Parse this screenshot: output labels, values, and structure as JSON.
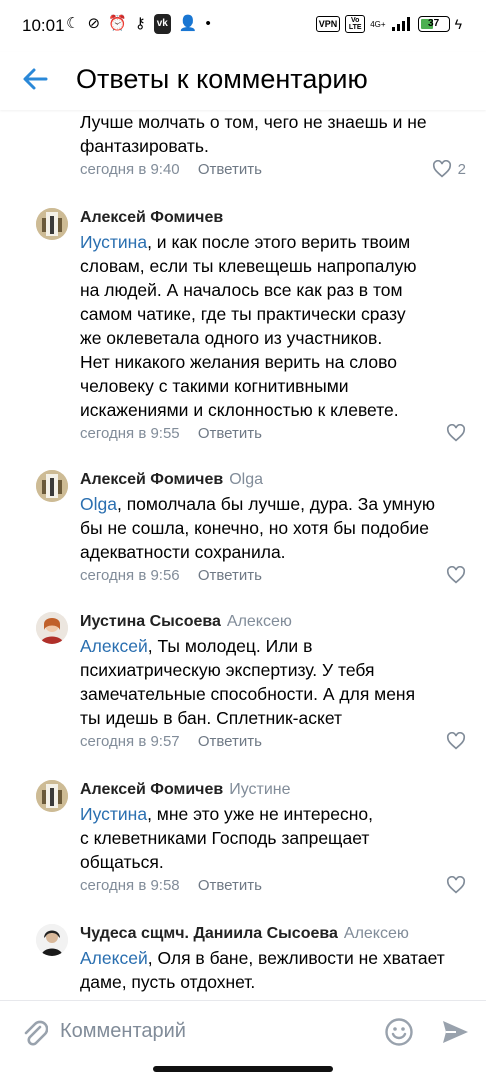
{
  "status_bar": {
    "time": "10:01",
    "vpn": "VPN",
    "volte": "Vo LTE",
    "network": "4G+",
    "battery": "37"
  },
  "header": {
    "title": "Ответы к комментарию"
  },
  "comments": [
    {
      "text_lines": [
        "Лучше молчать о том, чего не знаешь и не",
        "фантазировать."
      ],
      "time": "сегодня в 9:40",
      "reply_label": "Ответить",
      "likes": "2"
    },
    {
      "author": "Алексей Фомичев",
      "reply_to": "",
      "mention": "Иустина",
      "text_lines": [
        ", и как после этого верить твоим",
        "словам, если ты клевещешь напропалую",
        "на людей. А началось все как раз в том",
        "самом чатике, где ты практически сразу",
        "же оклеветала одного из участников.",
        "Нет никакого желания верить на слово",
        "человеку с такими когнитивными",
        "искажениями и склонностью к клевете."
      ],
      "time": "сегодня в 9:55",
      "reply_label": "Ответить"
    },
    {
      "author": "Алексей Фомичев",
      "reply_to": "Olga",
      "mention": "Olga",
      "text_lines": [
        ", помолчала бы лучше, дура. За умную",
        "бы не сошла, конечно, но хотя бы подобие",
        "адекватности сохранила."
      ],
      "time": "сегодня в 9:56",
      "reply_label": "Ответить"
    },
    {
      "author": "Иустина Сысоева",
      "reply_to": "Алексею",
      "mention": "Алексей",
      "text_lines": [
        ", Ты молодец. Или в",
        "психиатрическую экспертизу. У тебя",
        "замечательные способности. А для меня",
        "ты идешь в бан. Сплетник-аскет"
      ],
      "time": "сегодня в 9:57",
      "reply_label": "Ответить"
    },
    {
      "author": "Алексей Фомичев",
      "reply_to": "Иустине",
      "mention": "Иустина",
      "text_lines": [
        ", мне это уже не интересно,",
        "с клеветниками Господь запрещает",
        "общаться."
      ],
      "time": "сегодня в 9:58",
      "reply_label": "Ответить"
    },
    {
      "author": "Чудеса сщмч. Даниила Сысоева",
      "reply_to": "Алексею",
      "mention": "Алексей",
      "text_lines": [
        ", Оля в бане, вежливости не хватает",
        "даме, пусть отдохнет."
      ]
    }
  ],
  "composer": {
    "placeholder": "Комментарий"
  },
  "colors": {
    "accent": "#2a6fb0",
    "secondary_text": "#818c99",
    "battery_fill": "#4caf50"
  }
}
